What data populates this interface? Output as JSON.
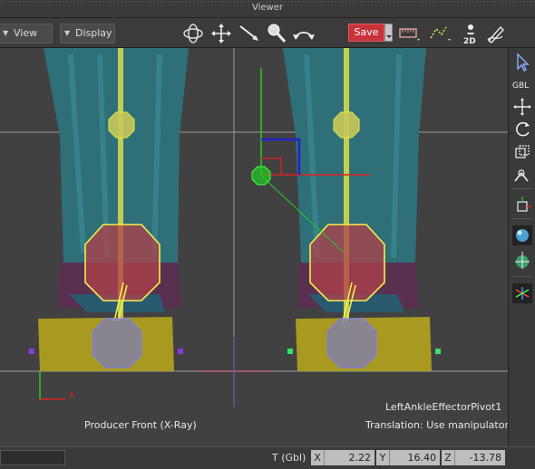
{
  "window": {
    "title": "Viewer"
  },
  "toolbar": {
    "view_label": "View",
    "display_label": "Display",
    "save_label": "Save",
    "icons": [
      "orbit-icon",
      "move-icon",
      "pan-icon",
      "zoom-icon",
      "rotate-view-icon",
      "ruler-icon",
      "path-icon",
      "2d-pan-icon",
      "pen-icon"
    ],
    "mode_2d_label": "2D"
  },
  "right_toolbar": {
    "icons": [
      "select-arrow-icon",
      "global-icon",
      "translate-icon",
      "rotate-icon",
      "scale-icon",
      "transform-icon",
      "pivot-icon",
      "sphere-icon",
      "sphere-move-icon",
      "axis-icon"
    ],
    "gbl_label": "GBL"
  },
  "viewport": {
    "camera_label": "Producer Front (X-Ray)",
    "selected_object": "LeftAnkleEffectorPivot1",
    "manipulator_hint": "Translation: Use manipulator",
    "axis_x_label": "X",
    "colors": {
      "background": "#414141",
      "skin": "#2f6f78",
      "effector_yellow": "#e6e64a",
      "foot_yellow": "#a89a20",
      "grid": "#9a9a9a"
    }
  },
  "status": {
    "transform_label": "T (Gbl)",
    "x_label": "X",
    "x_value": "2.22",
    "y_label": "Y",
    "y_value": "16.40",
    "z_label": "Z",
    "z_value": "-13.78"
  }
}
